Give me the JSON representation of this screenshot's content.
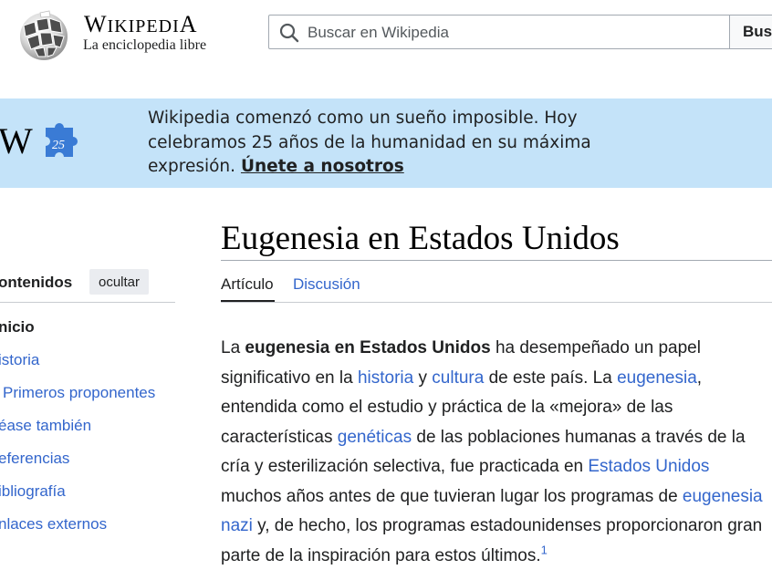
{
  "header": {
    "wordmark_first": "W",
    "wordmark_rest": "IKIPEDI",
    "wordmark_last": "A",
    "tagline": "La enciclopedia libre",
    "search_placeholder": "Buscar en Wikipedia",
    "search_button": "Bus"
  },
  "banner": {
    "logo_letter": "W",
    "logo_number": "25",
    "text": "Wikipedia comenzó como un sueño imposible. Hoy celebramos 25 años de la humanidad en su máxima expresión.",
    "link": "Únete a nosotros",
    "background": "#c4e3f9",
    "puzzle_color": "#3a7bd5"
  },
  "toc": {
    "title": "ontenidos",
    "hide_label": "ocultar",
    "items": [
      "nicio",
      "istoria",
      "Primeros proponentes",
      "éase también",
      "eferencias",
      "ibliografía",
      "nlaces externos"
    ]
  },
  "article": {
    "title": "Eugenesia en Estados Unidos",
    "tabs": [
      "Artículo",
      "Discusión"
    ],
    "p": [
      "La ",
      "eugenesia en Estados Unidos",
      " ha desempeñado un papel significativo en la ",
      "historia",
      " y ",
      "cultura",
      " de este país. La ",
      "eugenesia",
      ", entendida como el estudio y práctica de la «mejora» de las características ",
      "genéticas",
      " de las poblaciones humanas a través de la cría y esterilización selectiva, fue practicada en ",
      "Estados Unidos",
      " muchos años antes de que tuvieran lugar los programas de ",
      "eugenesia nazi",
      " y, de hecho, los programas estadounidenses proporcionaron gran parte de la inspiración para estos últimos.",
      "1"
    ]
  },
  "colors": {
    "link": "#3366cc",
    "text": "#202122"
  }
}
